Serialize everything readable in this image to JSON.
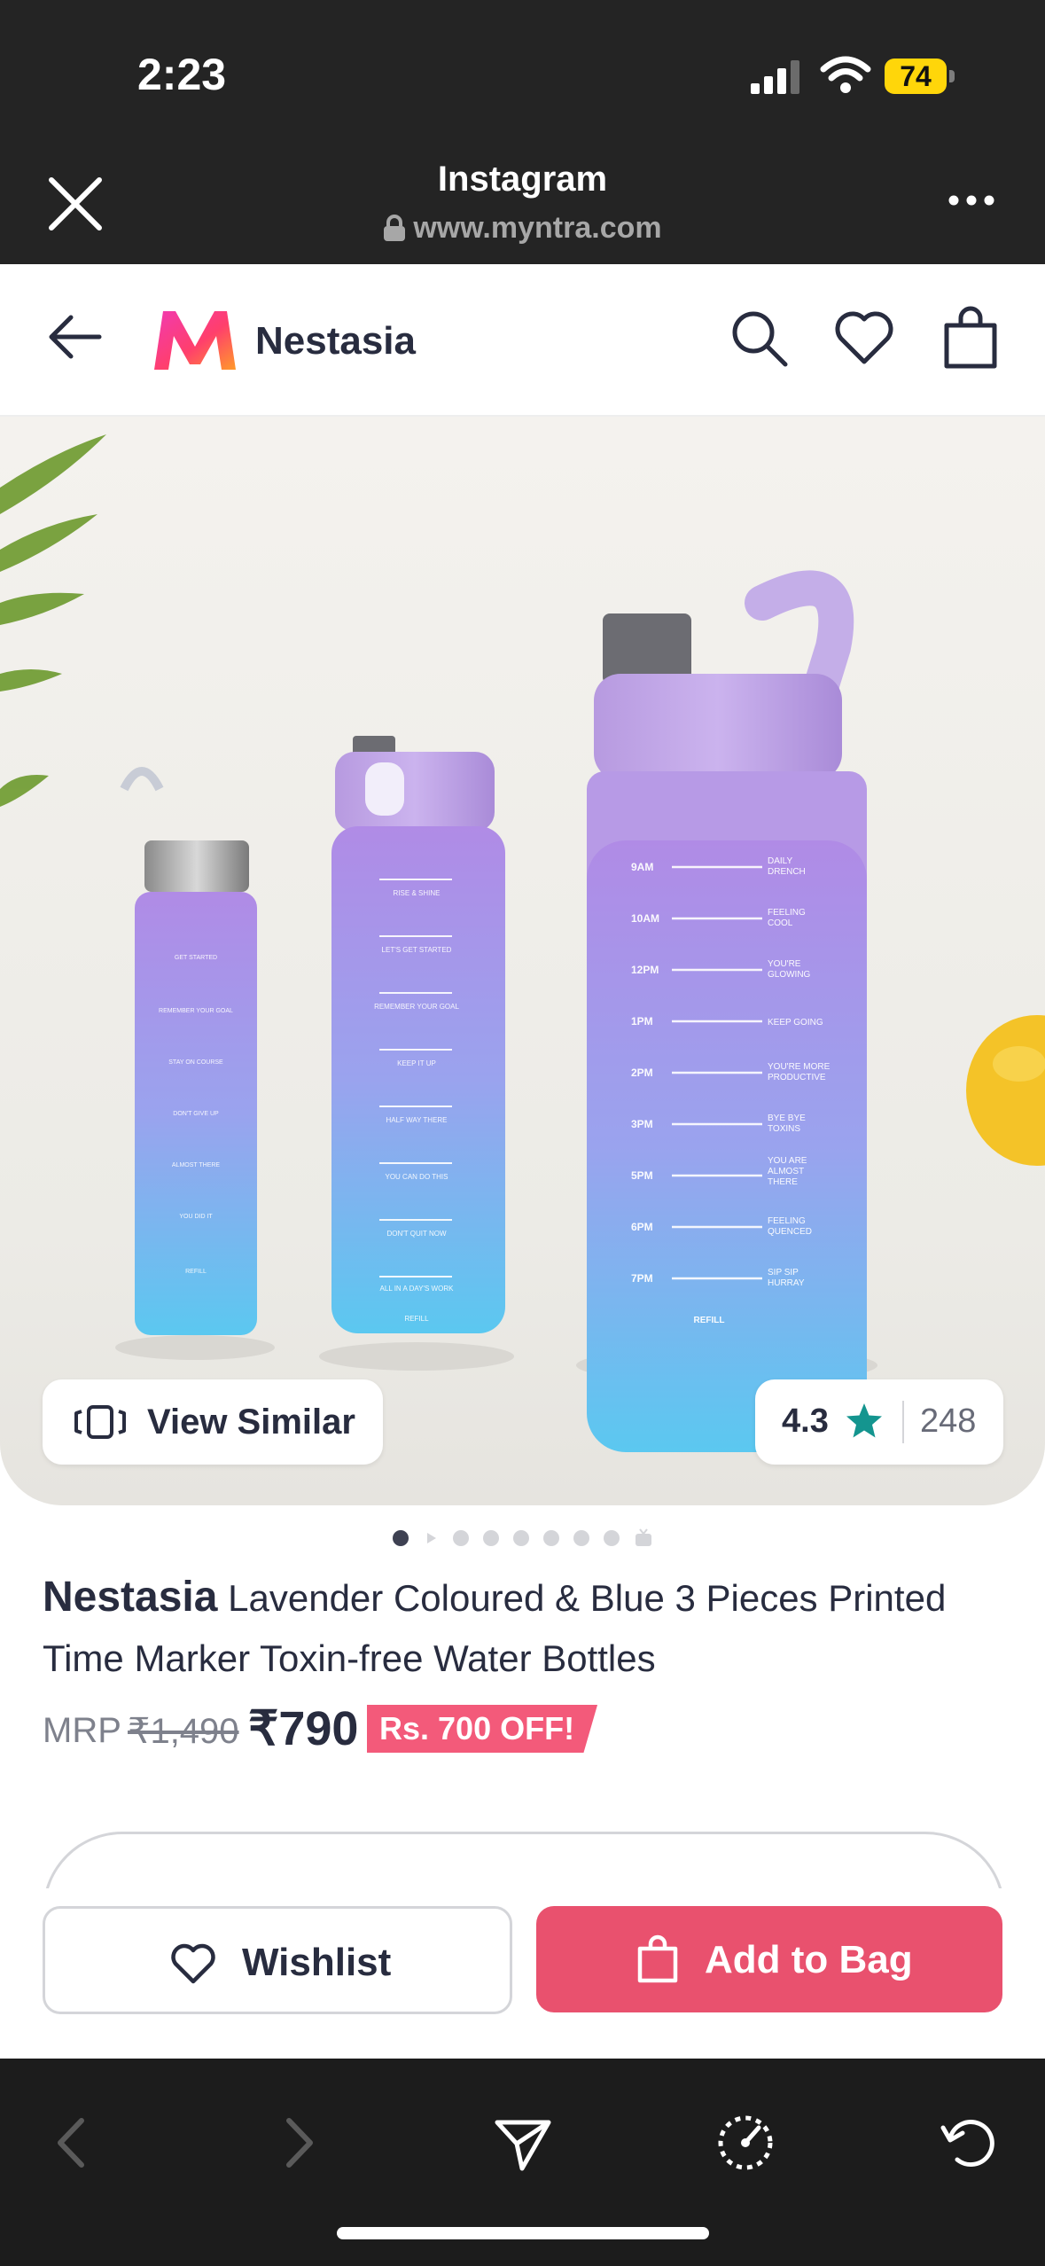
{
  "status_bar": {
    "time": "2:23",
    "battery": "74"
  },
  "browser_header": {
    "title": "Instagram",
    "url": "www.myntra.com"
  },
  "store_header": {
    "brand": "Nestasia"
  },
  "product": {
    "brand": "Nestasia",
    "name": "Lavender Coloured & Blue 3 Pieces Printed Time Marker Toxin-free Water Bottles",
    "mrp_label": "MRP",
    "mrp": "₹1,490",
    "price": "₹790",
    "offer": "Rs. 700 OFF!",
    "rating": "4.3",
    "rating_count": "248"
  },
  "image_overlay": {
    "view_similar_label": "View Similar"
  },
  "carousel": {
    "total_items": 9,
    "active_index": 0
  },
  "actions": {
    "wishlist_label": "Wishlist",
    "add_to_bag_label": "Add to Bag"
  },
  "bottle_markings": {
    "large_times": [
      "9AM",
      "10AM",
      "12PM",
      "1PM",
      "2PM",
      "3PM",
      "5PM",
      "6PM",
      "7PM"
    ],
    "large_notes": [
      "DAILY DRENCH",
      "FEELING COOL",
      "YOU'RE GLOWING",
      "KEEP GOING",
      "YOU'RE MORE PRODUCTIVE",
      "BYE BYE TOXINS",
      "YOU ARE ALMOST THERE",
      "FEELING QUENCED",
      "SIP SIP HURRAY"
    ],
    "refill": "REFILL",
    "medium_notes": [
      "RISE & SHINE",
      "LET'S GET STARTED",
      "REMEMBER YOUR GOAL",
      "KEEP IT UP",
      "HALF WAY THERE",
      "YOU CAN DO THIS",
      "DON'T QUIT NOW",
      "ALL IN A DAY'S WORK"
    ],
    "small_notes": [
      "GET STARTED",
      "REMEMBER YOUR GOAL",
      "STAY ON COURSE",
      "DON'T GIVE UP",
      "ALMOST THERE",
      "YOU DID IT",
      "REFILL"
    ]
  },
  "colors": {
    "header_bg": "#242424",
    "accent_pink": "#e9516e",
    "offer_badge": "#f35a7a",
    "rating_star": "#14958f",
    "battery": "#ffd60a"
  },
  "icons": {
    "close": "close-icon",
    "lock": "lock-icon",
    "more": "more-icon",
    "back": "back-arrow-icon",
    "search": "search-icon",
    "wishlist": "heart-icon",
    "bag": "bag-icon",
    "star": "star-icon"
  }
}
